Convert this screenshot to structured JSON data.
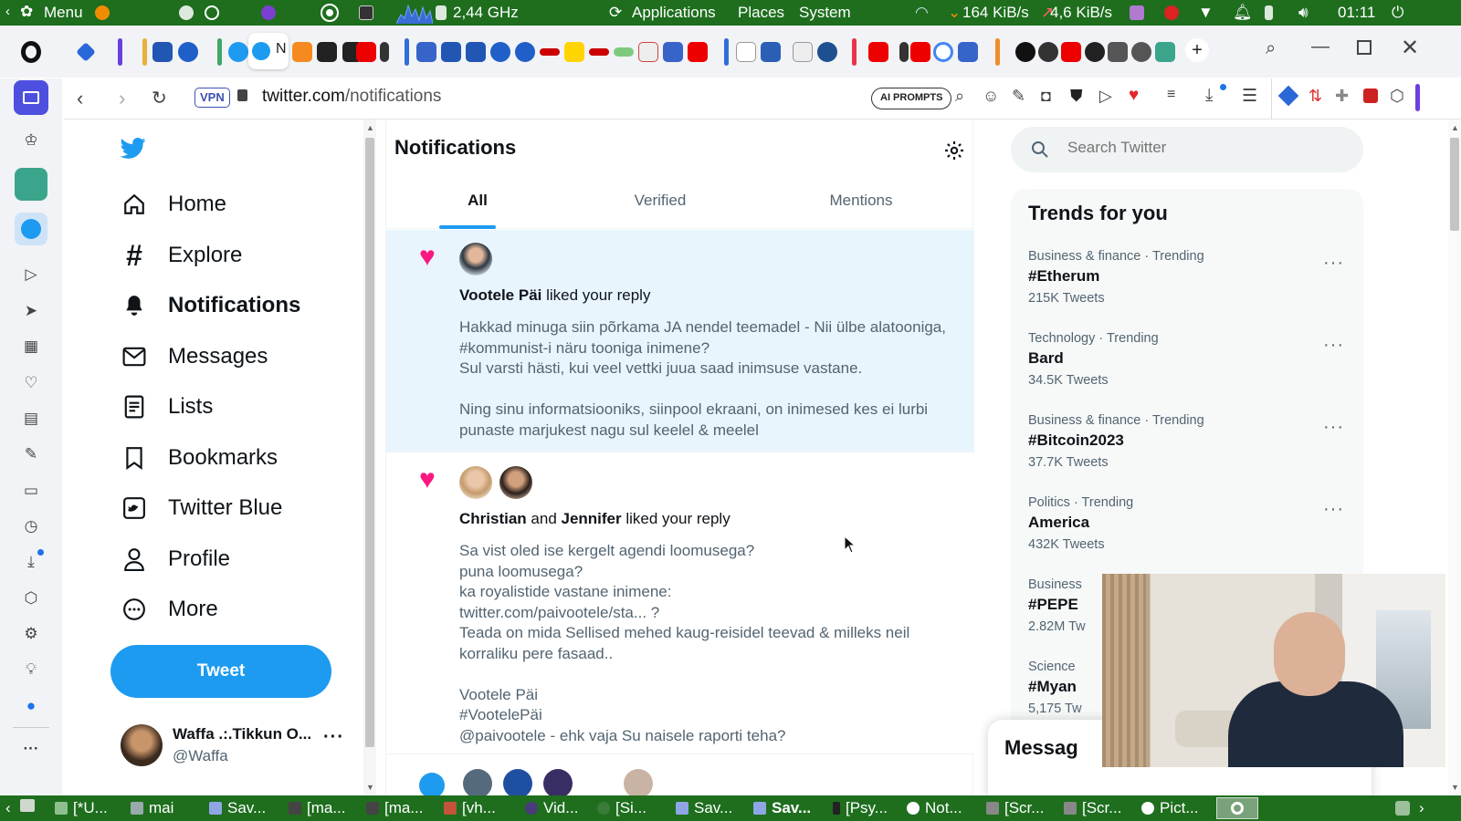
{
  "system_bar": {
    "menu_label": "Menu",
    "cpu_freq": "2,44 GHz",
    "applications": "Applications",
    "places": "Places",
    "system": "System",
    "net_down": "164 KiB/s",
    "net_up": "4,6 KiB/s",
    "clock": "01:11"
  },
  "browser": {
    "url_domain": "twitter.com",
    "url_path": "/notifications",
    "vpn_label": "VPN",
    "ai_prompts_label": "AI PROMPTS"
  },
  "twitter": {
    "nav": [
      {
        "label": "Home",
        "icon": "home-icon"
      },
      {
        "label": "Explore",
        "icon": "hashtag-icon"
      },
      {
        "label": "Notifications",
        "icon": "bell-icon",
        "active": true
      },
      {
        "label": "Messages",
        "icon": "mail-icon"
      },
      {
        "label": "Lists",
        "icon": "list-icon"
      },
      {
        "label": "Bookmarks",
        "icon": "bookmark-icon"
      },
      {
        "label": "Twitter Blue",
        "icon": "twitter-blue-icon"
      },
      {
        "label": "Profile",
        "icon": "person-icon"
      },
      {
        "label": "More",
        "icon": "more-circle-icon"
      }
    ],
    "tweet_button": "Tweet",
    "account": {
      "name": "Waffa .:.Tikkun O...",
      "handle": "@Waffa"
    },
    "page_title": "Notifications",
    "tabs": [
      "All",
      "Verified",
      "Mentions"
    ],
    "notifications": [
      {
        "actor1": "Vootele Päi",
        "action": " liked your reply",
        "text": [
          "Hakkad minuga siin põrkama JA nendel teemadel - Nii ülbe alatooniga,",
          "#kommunist-i näru tooniga inimene?",
          "Sul varsti hästi, kui veel vettki juua saad inimsuse vastane.",
          "",
          "Ning sinu informatsiooniks, siinpool ekraani, on inimesed kes ei lurbi",
          "punaste marjukest nagu sul keelel & meelel"
        ]
      },
      {
        "actor1": "Christian",
        "connector": " and ",
        "actor2": "Jennifer",
        "action": " liked your reply",
        "text": [
          "Sa vist oled ise kergelt agendi loomusega?",
          "puna loomusega?",
          "ka royalistide vastane inimene:",
          "twitter.com/paivootele/sta... ?",
          "Teada on mida Sellised mehed kaug-reisidel teevad & milleks neil",
          "korraliku pere fasaad..",
          "",
          "Vootele Päi",
          "#VootelePäi",
          "@paivootele - ehk vaja Su naisele raporti teha?"
        ]
      }
    ],
    "search_placeholder": "Search Twitter",
    "trends_title": "Trends for you",
    "trends": [
      {
        "category": "Business & finance · Trending",
        "name": "#Etherum",
        "count": "215K Tweets"
      },
      {
        "category": "Technology · Trending",
        "name": "Bard",
        "count": "34.5K Tweets"
      },
      {
        "category": "Business & finance · Trending",
        "name": "#Bitcoin2023",
        "count": "37.7K Tweets"
      },
      {
        "category": "Politics · Trending",
        "name": "America",
        "count": "432K Tweets"
      },
      {
        "category": "Business",
        "name": "#PEPE",
        "count": "2.82M Tw"
      },
      {
        "category": "Science",
        "name": "#Myan",
        "count": "5,175 Tw"
      }
    ],
    "messages_label": "Messag"
  },
  "taskbar": [
    "[*U...",
    "mai",
    "Sav...",
    "[ma...",
    "[ma...",
    "[vh...",
    "Vid...",
    "[Si...",
    "Sav...",
    "Sav...",
    "[Psy...",
    "Not...",
    "[Scr...",
    "[Scr...",
    "Pict..."
  ],
  "colors": {
    "accent": "#1d9bf0",
    "system_bar": "#1e6e1e",
    "heart": "#f91880",
    "unread_bg": "#e8f5fd"
  }
}
